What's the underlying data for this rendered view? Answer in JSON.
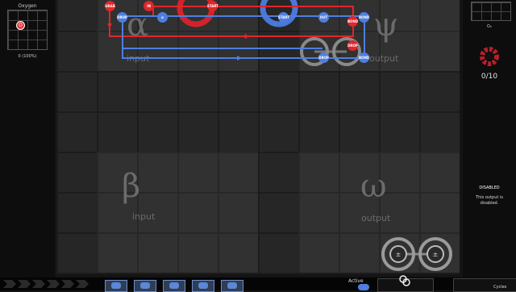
{
  "left_panel": {
    "title": "Oxygen",
    "molecule_symbol": "O",
    "count": "0 (100%)"
  },
  "right_panel": {
    "formula": "O₂",
    "progress": "0/10",
    "disabled_title": "DISABLED",
    "disabled_msg": "This output is disabled."
  },
  "board": {
    "alpha": {
      "glyph": "α",
      "label": "input"
    },
    "psi": {
      "glyph": "ψ",
      "label": "output"
    },
    "beta": {
      "glyph": "β",
      "label": "input"
    },
    "omega": {
      "glyph": "ω",
      "label": "output"
    }
  },
  "waldo_red": {
    "grab": "GRAB",
    "start": "START",
    "drop": "DROP",
    "in": "IN",
    "in_sym": "α",
    "bond": "BOND"
  },
  "waldo_blue": {
    "drop": "DROP",
    "start": "START",
    "out": "OUT",
    "out_sym": "ψ",
    "bond": "BOND"
  },
  "bottom": {
    "active_label": "Active",
    "cycles_label": "Cycles",
    "tool_labels": [
      "BOND",
      "GRAB",
      "IN",
      "OUT"
    ]
  },
  "colors": {
    "red": "#e1262b",
    "blue": "#4f7ee0"
  }
}
